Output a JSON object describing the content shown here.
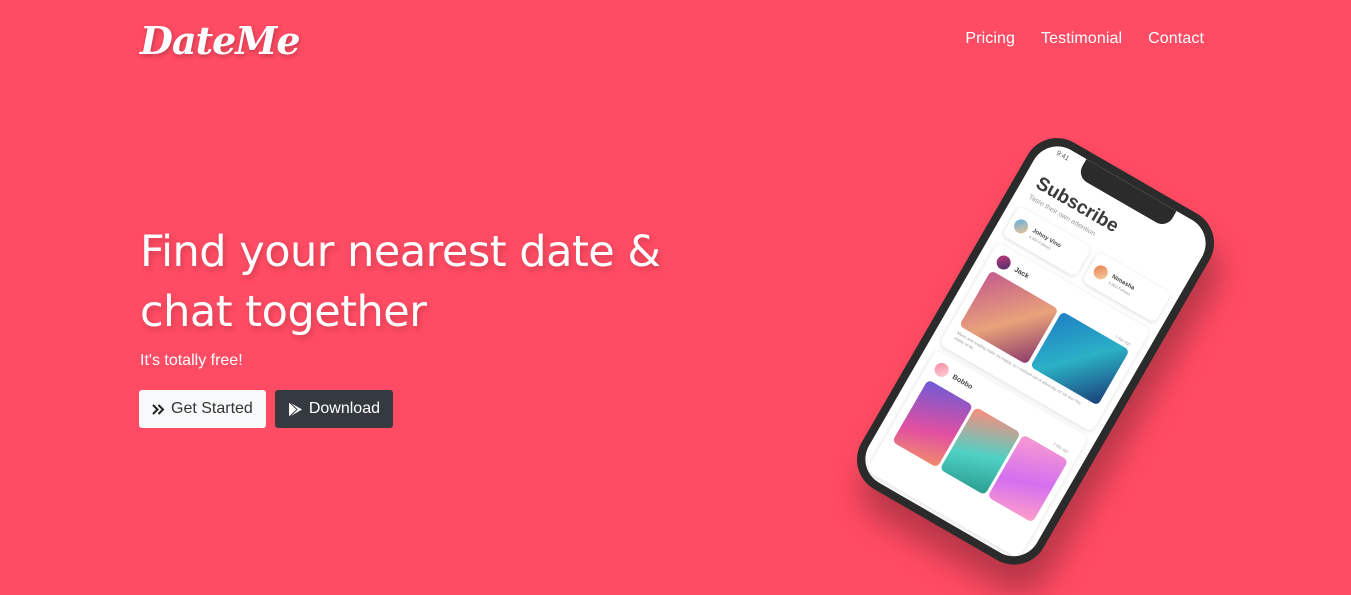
{
  "nav": {
    "brand": "DateMe",
    "links": [
      "Pricing",
      "Testimonial",
      "Contact"
    ]
  },
  "hero": {
    "title_line1": "Find your nearest date &",
    "title_line2": "chat together",
    "subtitle": "It's totally free!",
    "btn_get_started": "Get Started",
    "btn_download": "Download"
  },
  "phone": {
    "time": "9:41",
    "title": "Subscribe",
    "subtitle": "Taste their own attention",
    "stories": [
      {
        "name": "Johny Vino",
        "meta": "4,803 Follows"
      },
      {
        "name": "Nimasha",
        "meta": "9,862 Follows"
      }
    ],
    "posts": [
      {
        "name": "Jack",
        "time": "1 day ago",
        "caption": "Music and reading make me happy, so I realised out of adversity, let me feel The vitality of life"
      },
      {
        "name": "Bobbo",
        "time": "2 day ago"
      }
    ]
  },
  "colors": {
    "background": "#ff4b63",
    "btn_light": "#f8f9fa",
    "btn_dark": "#343a40"
  }
}
